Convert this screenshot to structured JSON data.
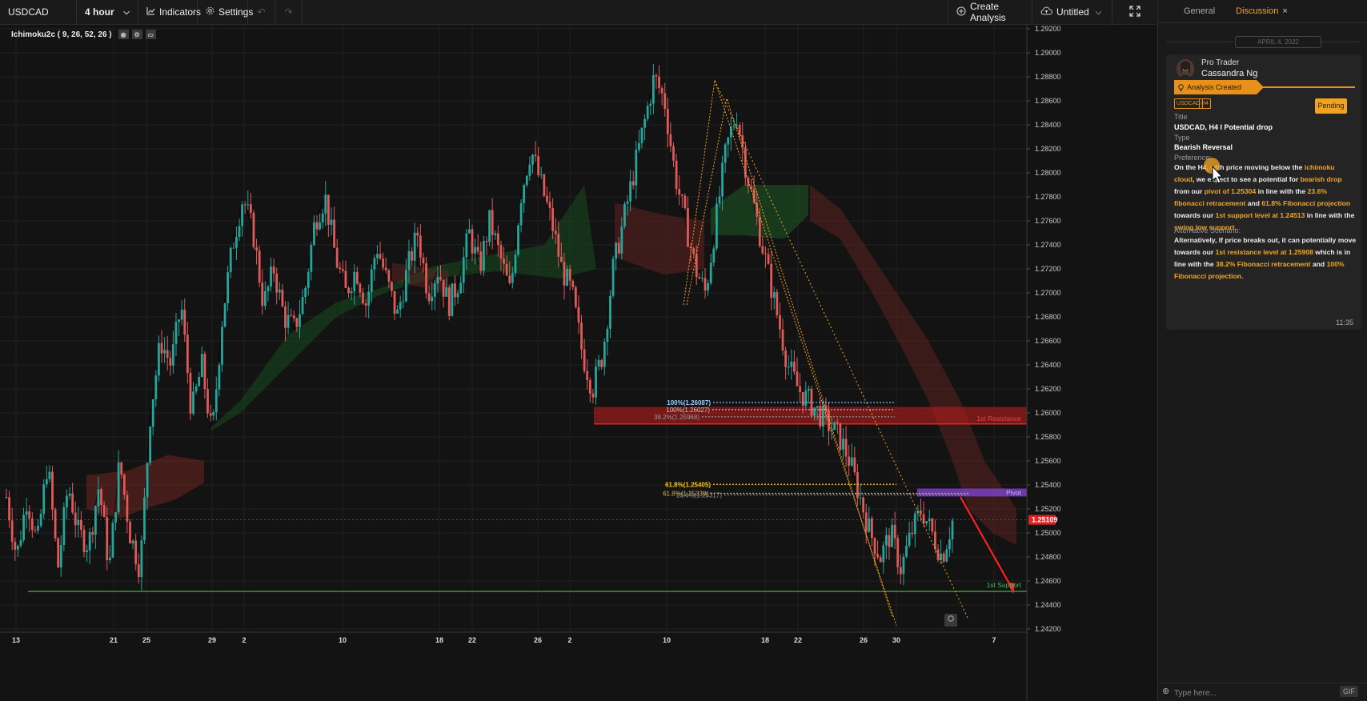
{
  "toolbar": {
    "symbol": "USDCAD",
    "timeframe": "4 hour",
    "indicators_label": "Indicators",
    "settings_label": "Settings",
    "create_analysis_label": "Create Analysis",
    "layout_name": "Untitled"
  },
  "study": {
    "label": "Ichimoku2c ( 9, 26, 52, 26 )"
  },
  "chart_data": {
    "type": "candlestick",
    "symbol": "USDCAD",
    "timeframe": "4 hour",
    "ylim": [
      1.242,
      1.292
    ],
    "y_ticks": [
      "1.29200",
      "1.29000",
      "1.28800",
      "1.28600",
      "1.28400",
      "1.28200",
      "1.28000",
      "1.27800",
      "1.27600",
      "1.27400",
      "1.27200",
      "1.27000",
      "1.26800",
      "1.26600",
      "1.26400",
      "1.26200",
      "1.26000",
      "1.25800",
      "1.25600",
      "1.25400",
      "1.25200",
      "1.25000",
      "1.24800",
      "1.24600",
      "1.24400",
      "1.24200"
    ],
    "x_ticks": [
      "13",
      "21",
      "25",
      "29",
      "2",
      "10",
      "18",
      "22",
      "26",
      "2",
      "10",
      "18",
      "22",
      "26",
      "30",
      "7"
    ],
    "current_price": "1.25109",
    "price_path": [
      1.253,
      1.248,
      1.253,
      1.249,
      1.256,
      1.247,
      1.254,
      1.25,
      1.249,
      1.254,
      1.247,
      1.256,
      1.25,
      1.247,
      1.26,
      1.266,
      1.264,
      1.269,
      1.26,
      1.264,
      1.258,
      1.268,
      1.274,
      1.278,
      1.275,
      1.269,
      1.272,
      1.268,
      1.267,
      1.27,
      1.276,
      1.278,
      1.273,
      1.27,
      1.272,
      1.269,
      1.274,
      1.271,
      1.268,
      1.272,
      1.275,
      1.27,
      1.272,
      1.269,
      1.271,
      1.275,
      1.272,
      1.276,
      1.273,
      1.27,
      1.278,
      1.282,
      1.279,
      1.276,
      1.272,
      1.27,
      1.265,
      1.262,
      1.265,
      1.272,
      1.276,
      1.28,
      1.284,
      1.288,
      1.286,
      1.28,
      1.276,
      1.272,
      1.27,
      1.276,
      1.282,
      1.285,
      1.28,
      1.276,
      1.272,
      1.268,
      1.264,
      1.262,
      1.261,
      1.26,
      1.259,
      1.258,
      1.256,
      1.253,
      1.25,
      1.248,
      1.25,
      1.247,
      1.25,
      1.252,
      1.25,
      1.248,
      1.251
    ],
    "levels": [
      {
        "label": "1st Resistance",
        "value": 1.25908,
        "color": "#e02424"
      },
      {
        "label": "Pivot",
        "value": 1.25304,
        "color": "#7b3fc4"
      },
      {
        "label": "1st Support",
        "value": 1.24513,
        "color": "#2fa84a"
      }
    ],
    "fib_labels": [
      {
        "label": "100%(1.26087)",
        "value": 1.26087,
        "color": "#9ecbff"
      },
      {
        "label": "100%(1.26027)",
        "value": 1.26027,
        "color": "#c8c8c8"
      },
      {
        "label": "38.2%(1.25968)",
        "value": 1.25968,
        "color": "#9a9a9a"
      },
      {
        "label": "61.8%(1.25405)",
        "value": 1.25405,
        "color": "#f5c518"
      },
      {
        "label": "61.8%(1.25330)",
        "value": 1.2533,
        "color": "#d9b24a"
      },
      {
        "label": "23.6%(1.25317)",
        "value": 1.25317,
        "color": "#9a9a9a"
      }
    ]
  },
  "panel": {
    "tabs": [
      "General",
      "Discussion"
    ],
    "active_tab": "Discussion",
    "date": "APRIL 4, 2022",
    "author_role": "Pro Trader",
    "author_name": "Cassandra Ng",
    "ribbon": "Analysis Created",
    "tags": [
      "USDCAD",
      "H4"
    ],
    "status": "Pending",
    "title_label": "Title",
    "title_value": "USDCAD, H4 I Potential drop",
    "type_label": "Type",
    "type_value": "Bearish Reversal",
    "preference_label": "Preference:",
    "pref": {
      "t1": "On the H4, with price moving below the ",
      "h1": "ichimoku cloud",
      "t2": ", we expect to see a potential for ",
      "h2": "bearish drop",
      "t3": " from our ",
      "h3": "pivot of 1.25304",
      "t4": " in line with the ",
      "h4": "23.6% fibonacci retracement",
      "t5": " and ",
      "h5": "61.8% Fibonacci projection",
      "t6": " towards our ",
      "h6": "1st support level at 1.24513",
      "t7": " in line with the ",
      "h7": "swing low support.",
      "t8": ""
    },
    "alt_label": "Alternative Scenario:",
    "alt": {
      "t1": "Alternatively, If price breaks out, it can potentially move towards our ",
      "h1": "1st resistance level at 1.25908",
      "t2": " which is in line with the ",
      "h2": "38.2% Fibonacci retracement",
      "t3": " and ",
      "h3": "100% Fibonacci projection.",
      "t4": ""
    },
    "time": "11:35",
    "message_placeholder": "Type here...",
    "gif_label": "GIF"
  }
}
